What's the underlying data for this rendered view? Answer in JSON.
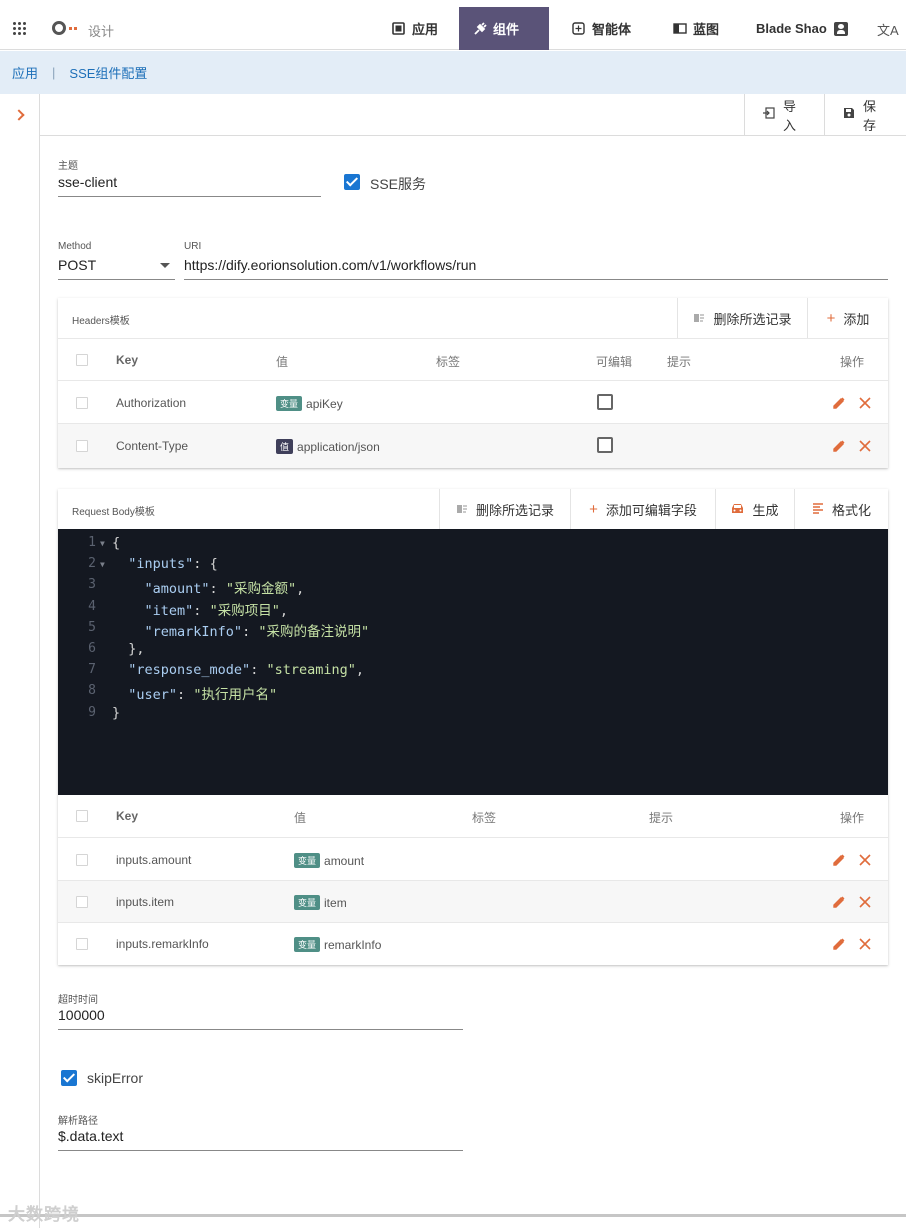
{
  "topbar": {
    "brand": "设计",
    "nav": [
      {
        "label": "应用",
        "icon": "app-icon"
      },
      {
        "label": "组件",
        "icon": "plugin-icon",
        "active": true
      },
      {
        "label": "智能体",
        "icon": "agent-icon"
      },
      {
        "label": "蓝图",
        "icon": "blueprint-icon"
      }
    ],
    "user": "Blade Shao",
    "translate": "文A"
  },
  "breadcrumb": {
    "root": "应用",
    "separator": "|",
    "current": "SSE组件配置"
  },
  "actions": {
    "import": "导入",
    "save": "保存"
  },
  "form": {
    "topic_label": "主题",
    "topic_value": "sse-client",
    "sse_service_label": "SSE服务",
    "sse_service_checked": true,
    "method_label": "Method",
    "method_value": "POST",
    "uri_label": "URI",
    "uri_value": "https://dify.eorionsolution.com/v1/workflows/run",
    "timeout_label": "超时时间",
    "timeout_value": "100000",
    "skip_error_label": "skipError",
    "skip_error_checked": true,
    "parse_path_label": "解析路径",
    "parse_path_value": "$.data.text"
  },
  "headers": {
    "title": "Headers模板",
    "delete_selected": "删除所选记录",
    "add": "添加",
    "columns": {
      "key": "Key",
      "value": "值",
      "tag": "标签",
      "editable": "可编辑",
      "hint": "提示",
      "actions": "操作"
    },
    "rows": [
      {
        "key": "Authorization",
        "value_type": "变量",
        "value": "apiKey"
      },
      {
        "key": "Content-Type",
        "value_type": "值",
        "value": "application/json"
      }
    ]
  },
  "request_body": {
    "title": "Request Body模板",
    "delete_selected": "删除所选记录",
    "add_editable": "添加可编辑字段",
    "generate": "生成",
    "format": "格式化",
    "code_lines": [
      "{",
      "  \"inputs\": {",
      "    \"amount\": \"采购金额\",",
      "    \"item\": \"采购项目\",",
      "    \"remarkInfo\": \"采购的备注说明\"",
      "  },",
      "  \"response_mode\": \"streaming\",",
      "  \"user\": \"执行用户名\"",
      "}"
    ],
    "columns": {
      "key": "Key",
      "value": "值",
      "tag": "标签",
      "hint": "提示",
      "actions": "操作"
    },
    "rows": [
      {
        "key": "inputs.amount",
        "value_type": "变量",
        "value": "amount"
      },
      {
        "key": "inputs.item",
        "value_type": "变量",
        "value": "item"
      },
      {
        "key": "inputs.remarkInfo",
        "value_type": "变量",
        "value": "remarkInfo"
      }
    ]
  },
  "watermark": "大数跨境",
  "colors": {
    "accent": "#5a5378",
    "link": "#1d6fb8",
    "danger": "#e06c3c",
    "checkbox": "#1976d2",
    "editor_bg": "#141821"
  }
}
